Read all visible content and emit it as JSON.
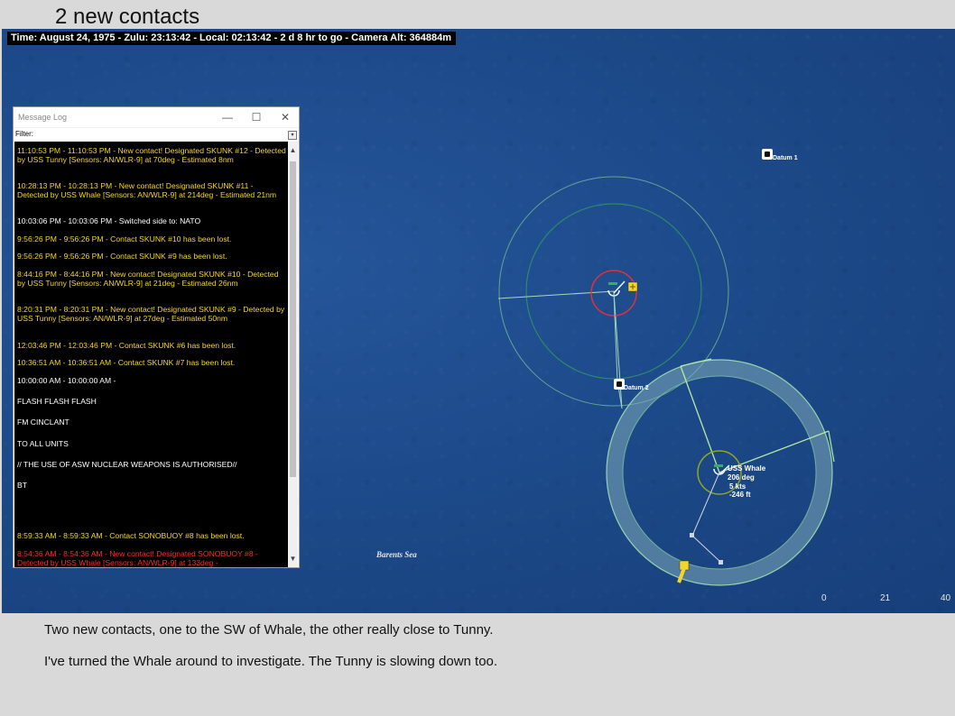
{
  "slide": {
    "title": "2 new contacts",
    "paragraphs": [
      "Two new contacts, one to the SW of Whale, the other really close to Tunny.",
      "I've turned the Whale around to investigate.  The Tunny is slowing down too."
    ]
  },
  "map": {
    "status_bar": "Time: August 24, 1975 - Zulu: 23:13:42 - Local: 02:13:42 - 2 d 8 hr to go -  Camera Alt: 364884m",
    "labels": {
      "datum1": "Datum 1",
      "datum2": "Datum 2",
      "whale_name": "USS Whale",
      "whale_course": "206 deg",
      "whale_speed": "5 kts",
      "whale_depth": "-246 ft",
      "sea": "Barents Sea"
    },
    "scale": [
      "0",
      "21",
      "40"
    ],
    "colors": {
      "ocean": "#1d4a8a",
      "range_ring_green": "#5fae8a",
      "sonar_band": "#9fd0b8",
      "contact_red": "#e03040",
      "contact_yellow": "#f5d628"
    }
  },
  "message_log": {
    "title": "Message Log",
    "filter_label": "Filter:",
    "window_buttons": {
      "minimize": "—",
      "maximize": "☐",
      "close": "✕"
    },
    "entries": [
      {
        "color": "yellow",
        "text": "11:10:53 PM - 11:10:53 PM - New contact! Designated SKUNK #12 - Detected by USS Tunny [Sensors: AN/WLR-9] at 70deg - Estimated 8nm"
      },
      {
        "color": "yellow",
        "text": "10:28:13 PM - 10:28:13 PM - New contact! Designated SKUNK #11 - Detected by USS Whale [Sensors: AN/WLR-9] at 214deg - Estimated 21nm"
      },
      {
        "color": "white",
        "text": "10:03:06 PM - 10:03:06 PM - Switched side to: NATO"
      },
      {
        "color": "yellow",
        "text": "9:56:26 PM - 9:56:26 PM - Contact SKUNK #10 has been lost."
      },
      {
        "color": "yellow",
        "text": "9:56:26 PM - 9:56:26 PM - Contact SKUNK #9 has been lost."
      },
      {
        "color": "yellow",
        "text": "8:44:16 PM - 8:44:16 PM - New contact! Designated SKUNK #10 - Detected by USS Tunny [Sensors: AN/WLR-9] at 21deg - Estimated 26nm"
      },
      {
        "color": "yellow",
        "text": "8:20:31 PM - 8:20:31 PM - New contact! Designated SKUNK #9 - Detected by USS Tunny [Sensors: AN/WLR-9] at 27deg - Estimated 50nm"
      },
      {
        "color": "yellow",
        "text": "12:03:46 PM - 12:03:46 PM - Contact SKUNK #6 has been lost."
      },
      {
        "color": "yellow",
        "text": "10:36:51 AM - 10:36:51 AM - Contact SKUNK #7 has been lost."
      },
      {
        "color": "white",
        "text": "10:00:00 AM - 10:00:00 AM -"
      },
      {
        "color": "white",
        "text": "FLASH FLASH FLASH"
      },
      {
        "color": "white",
        "text": "FM CINCLANT"
      },
      {
        "color": "white",
        "text": "TO ALL UNITS"
      },
      {
        "color": "white",
        "text": "// THE USE OF ASW NUCLEAR WEAPONS IS AUTHORISED//"
      },
      {
        "color": "white",
        "text": "BT"
      },
      {
        "color": "yellow",
        "text": "8:59:33 AM - 8:59:33 AM - Contact SONOBUOY #8 has been lost."
      },
      {
        "color": "red",
        "text": "8:54:36 AM - 8:54:36 AM - New contact! Designated SONOBUOY #8 - Detected by USS Whale [Sensors: AN/WLR-9] at 133deg -"
      }
    ]
  }
}
